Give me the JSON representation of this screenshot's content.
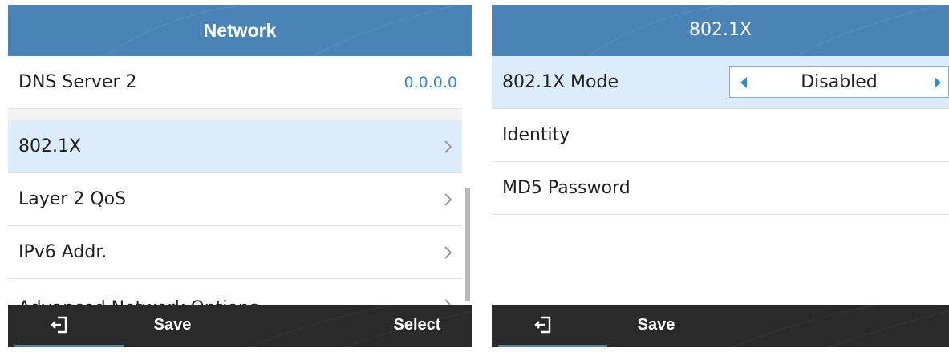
{
  "colors": {
    "title_bar": "#4a84b7",
    "softkey_bar": "#2a2a2a",
    "selected_row": "#ddecfa",
    "value_text": "#2d8cd8"
  },
  "left_screen": {
    "title": "Network",
    "rows": [
      {
        "label": "DNS Server 2",
        "value": "0.0.0.0"
      },
      {
        "label": "802.1X",
        "icon": "chevron-right-icon"
      },
      {
        "label": "Layer 2 QoS",
        "icon": "chevron-right-icon"
      },
      {
        "label": "IPv6 Addr.",
        "icon": "chevron-right-icon"
      },
      {
        "label": "Advanced Network Options",
        "icon": "chevron-right-icon"
      }
    ],
    "softkeys": {
      "back_icon": "exit-icon",
      "save": "Save",
      "select": "Select"
    }
  },
  "right_screen": {
    "title": "802.1X",
    "mode": {
      "label": "802.1X Mode",
      "value": "Disabled",
      "left_icon": "triangle-left-icon",
      "right_icon": "triangle-right-icon"
    },
    "rows": [
      {
        "label": "Identity"
      },
      {
        "label": "MD5 Password"
      }
    ],
    "softkeys": {
      "back_icon": "exit-icon",
      "save": "Save"
    }
  }
}
